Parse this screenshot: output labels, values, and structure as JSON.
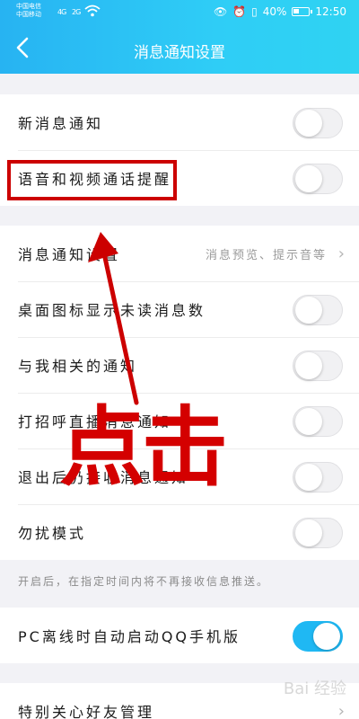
{
  "status_bar": {
    "carrier1": "中国电信",
    "carrier2": "中国移动",
    "net1": "4G",
    "net2": "2G",
    "battery": "40%",
    "time": "12:50"
  },
  "header": {
    "title": "消息通知设置"
  },
  "group1": [
    {
      "label": "新消息通知",
      "toggle_on": false
    },
    {
      "label": "语音和视频通话提醒",
      "toggle_on": false
    }
  ],
  "group2": {
    "settings": {
      "label": "消息通知设置",
      "value": "消息预览、提示音等"
    },
    "rows": [
      {
        "label": "桌面图标显示未读消息数",
        "toggle_on": false
      },
      {
        "label": "与我相关的通知",
        "toggle_on": false
      },
      {
        "label": "打招呼直播消息通知",
        "toggle_on": false
      },
      {
        "label": "退出后仍接收消息通知",
        "toggle_on": false
      },
      {
        "label": "勿扰模式",
        "toggle_on": false
      }
    ]
  },
  "dnd_note": "开启后，在指定时间内将不再接收信息推送。",
  "group3": {
    "label": "PC离线时自动启动QQ手机版",
    "toggle_on": true
  },
  "group4": {
    "label": "特别关心好友管理"
  },
  "annotation": {
    "text": "点击",
    "color": "#cc0000"
  },
  "watermark": "Bai 经验",
  "colors": {
    "header": "#2bc0f4",
    "toggle_on": "#1fb8f3",
    "annotation": "#cc0000"
  }
}
